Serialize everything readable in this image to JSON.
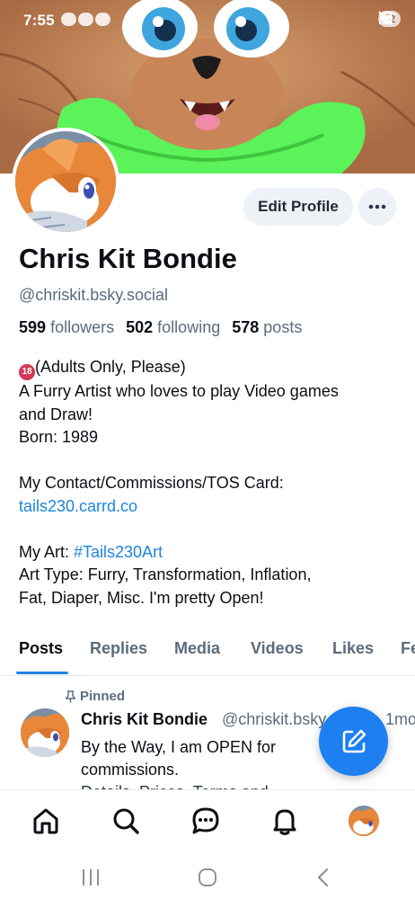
{
  "status_bar": {
    "time": "7:55",
    "battery": "42"
  },
  "profile": {
    "display_name": "Chris Kit Bondie",
    "handle": "@chriskit.bsky.social",
    "edit_label": "Edit Profile",
    "stats": {
      "followers_count": "599",
      "followers_label": "followers",
      "following_count": "502",
      "following_label": "following",
      "posts_count": "578",
      "posts_label": "posts"
    },
    "bio": {
      "line1": "(Adults Only, Please)",
      "line2": "A Furry Artist who loves to play Video games",
      "line3": "and Draw!",
      "line4": "Born: 1989",
      "line5": "My Contact/Commissions/TOS Card:",
      "link": "tails230.carrd.co",
      "art_prefix": "My Art: ",
      "art_tag": "#Tails230Art",
      "line7": "Art Type: Furry, Transformation, Inflation,",
      "line8": "Fat, Diaper, Misc. I'm pretty Open!"
    }
  },
  "tabs": [
    "Posts",
    "Replies",
    "Media",
    "Videos",
    "Likes",
    "Feeds"
  ],
  "pinned_post": {
    "pinned_label": "Pinned",
    "author_name": "Chris Kit Bondie",
    "author_handle": "@chriskit.bsky.social · 1mo",
    "text_line1": "By the Way, I am OPEN for",
    "text_line2": "commissions.",
    "text_line3": "Details, Prices, Terms and"
  },
  "colors": {
    "accent": "#1d84e0",
    "fab": "#1d7ff0",
    "muted_text": "#5a6b7d",
    "button_bg": "#eef1f5"
  },
  "icons": {
    "nav": [
      "home-icon",
      "search-icon",
      "chat-icon",
      "bell-icon",
      "profile-avatar"
    ],
    "system": [
      "recent-apps-icon",
      "home-circle-icon",
      "back-chevron-icon"
    ],
    "fab": "compose-icon"
  }
}
